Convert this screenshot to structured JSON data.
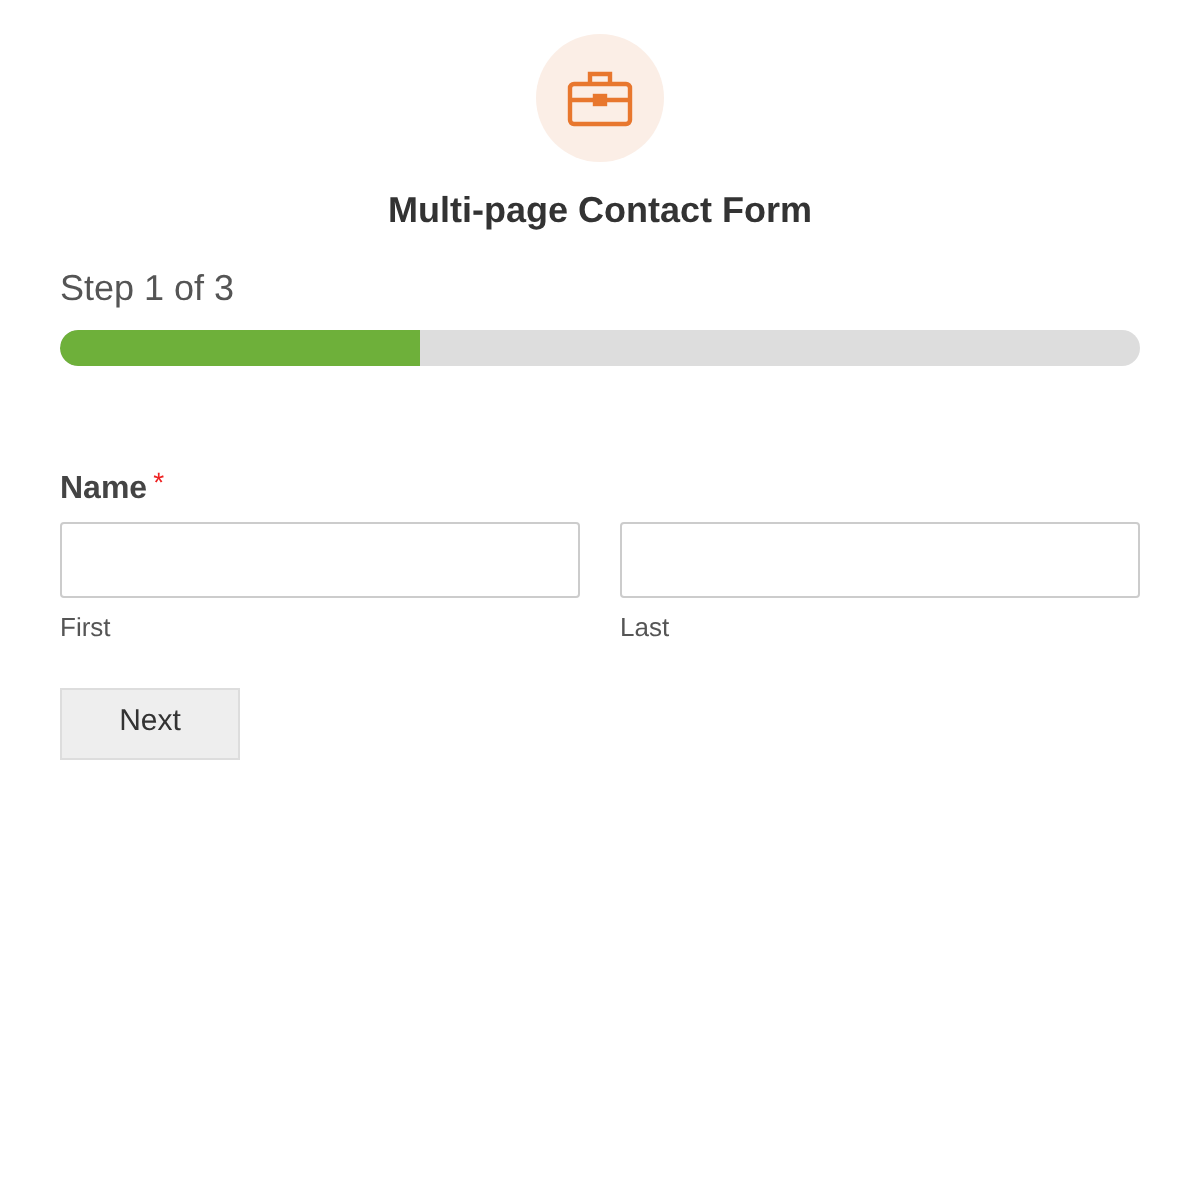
{
  "form": {
    "title": "Multi-page Contact Form"
  },
  "progress": {
    "label": "Step 1 of 3",
    "level": 0.333
  },
  "field": {
    "label": "Name",
    "required_mark": "*",
    "subfields": [
      {
        "sublabel": "First"
      },
      {
        "sublabel": "Last"
      }
    ]
  },
  "buttons": [
    {
      "label": "Next"
    }
  ]
}
